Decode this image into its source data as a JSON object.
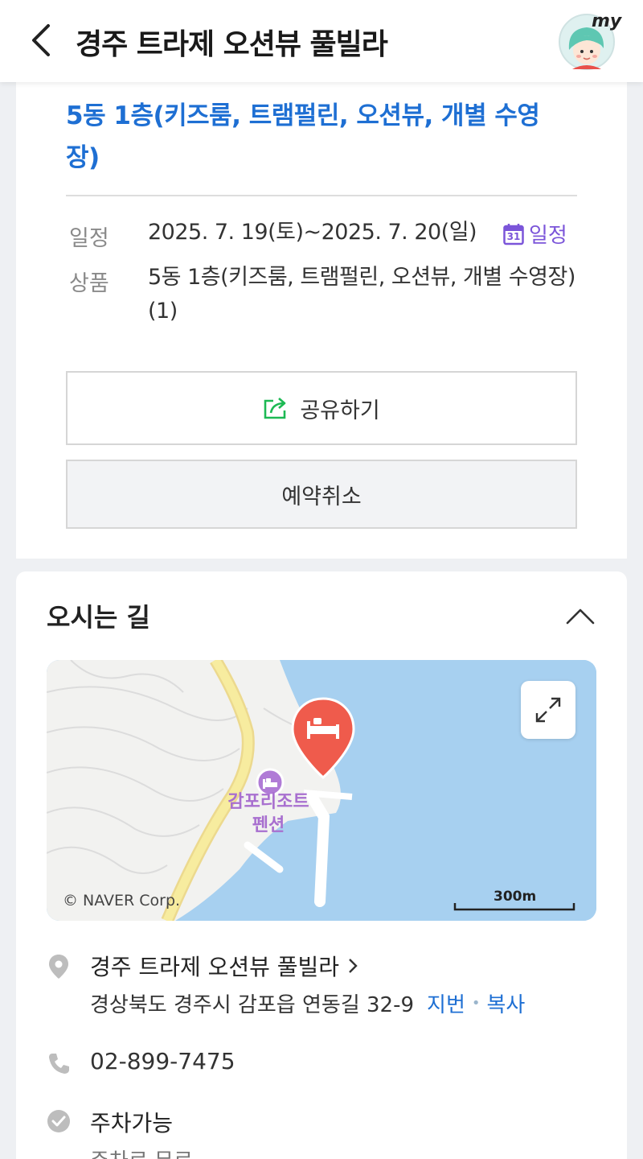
{
  "header": {
    "title": "경주 트라제 오션뷰 풀빌라",
    "my_label": "my",
    "back_icon": "chevron-left-icon"
  },
  "booking": {
    "product_title": "5동 1층(키즈룸, 트램펄린, 오션뷰, 개별 수영장)",
    "schedule_label": "일정",
    "schedule_value": "2025. 7. 19(토)~2025. 7. 20(일)",
    "schedule_link": "일정",
    "calendar_day": "31",
    "product_label": "상품",
    "product_value": "5동 1층(키즈룸, 트램펄린, 오션뷰, 개별 수영장)(1)",
    "share_label": "공유하기",
    "cancel_label": "예약취소"
  },
  "directions": {
    "title": "오시는 길",
    "map": {
      "poi_label_1": "감포리조트",
      "poi_label_2": "펜션",
      "copyright": "© NAVER Corp.",
      "scale": "300m"
    },
    "place_name": "경주 트라제 오션뷰 풀빌라",
    "address": "경상북도 경주시 감포읍 연동길 32-9",
    "jibun_label": "지번",
    "copy_label": "복사",
    "phone": "02-899-7475",
    "parking": "주차가능",
    "parking_fee": "주차료 무료"
  },
  "colors": {
    "accent_blue": "#1e6fd3",
    "calendar_purple": "#7b55d9",
    "pin_red": "#ef5b4c",
    "share_green": "#1db954",
    "sea": "#a7d0f0"
  }
}
